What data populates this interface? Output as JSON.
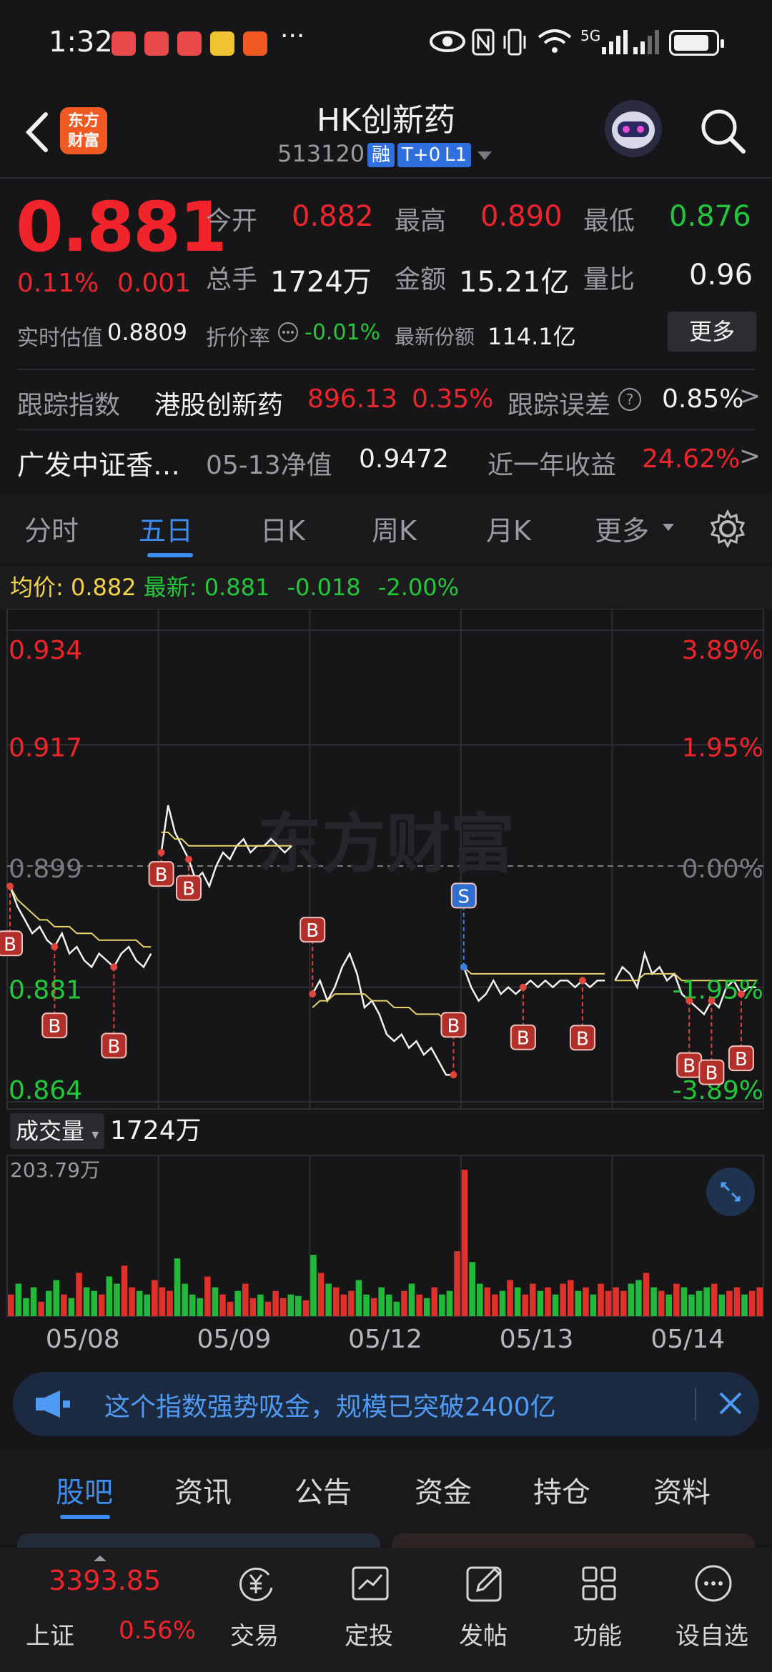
{
  "status_bar": {
    "time": "1:32",
    "more": "···",
    "network": "5G"
  },
  "header": {
    "logo_text_1": "东方",
    "logo_text_2": "财富",
    "title": "HK创新药",
    "code": "513120",
    "tags": [
      "融",
      "T+0",
      "L1"
    ]
  },
  "quote": {
    "price": "0.881",
    "change_pct": "0.11%",
    "change_amt": "0.001",
    "open_label": "今开",
    "open": "0.882",
    "high_label": "最高",
    "high": "0.890",
    "low_label": "最低",
    "low": "0.876",
    "volume_label": "总手",
    "volume": "1724万",
    "amount_label": "金额",
    "amount": "15.21亿",
    "ratio_label": "量比",
    "ratio": "0.96",
    "iopv_label": "实时估值",
    "iopv": "0.8809",
    "discount_label": "折价率",
    "discount": "-0.01%",
    "shares_label": "最新份额",
    "shares": "114.1亿",
    "more_btn": "更多"
  },
  "tracking": {
    "index_label": "跟踪指数",
    "index_name": "港股创新药",
    "index_value": "896.13",
    "index_pct": "0.35%",
    "error_label": "跟踪误差",
    "error_value": "0.85%",
    "fund_name": "广发中证香…",
    "nav_label": "05-13净值",
    "nav_value": "0.9472",
    "yield_label": "近一年收益",
    "yield_value": "24.62%",
    "chevron": ">"
  },
  "chart_tabs": [
    "分时",
    "五日",
    "日K",
    "周K",
    "月K",
    "更多"
  ],
  "chart_legend": {
    "avg_label": "均价:",
    "avg_value": "0.882",
    "latest_label": "最新:",
    "latest_value": "0.881",
    "chg": "-0.018",
    "chg_pct": "-2.00%"
  },
  "chart_data": {
    "type": "line",
    "x_labels": [
      "05/08",
      "05/09",
      "05/12",
      "05/13",
      "05/14"
    ],
    "y_left_ticks": [
      "0.934",
      "0.917",
      "0.899",
      "0.881",
      "0.864"
    ],
    "y_right_ticks": [
      "3.89%",
      "1.95%",
      "0.00%",
      "-1.95%",
      "-3.89%"
    ],
    "ylim": [
      0.864,
      0.934
    ],
    "prev_close": 0.899,
    "watermark": "东方财富",
    "series": [
      {
        "values": [
          0.896,
          0.893,
          0.891,
          0.889,
          0.89,
          0.888,
          0.887,
          0.889,
          0.886,
          0.887,
          0.885,
          0.884,
          0.886,
          0.885,
          0.884,
          0.886,
          0.887,
          0.885,
          0.884,
          0.886,
          0.901,
          0.908,
          0.904,
          0.902,
          0.9,
          0.897,
          0.898,
          0.896,
          0.899,
          0.901,
          0.9,
          0.902,
          0.903,
          0.901,
          0.902,
          0.902,
          0.903,
          0.902,
          0.901,
          0.902,
          0.88,
          0.882,
          0.879,
          0.881,
          0.884,
          0.886,
          0.883,
          0.878,
          0.879,
          0.877,
          0.874,
          0.873,
          0.874,
          0.872,
          0.873,
          0.871,
          0.872,
          0.87,
          0.868,
          0.868,
          0.884,
          0.881,
          0.879,
          0.88,
          0.882,
          0.88,
          0.881,
          0.88,
          0.881,
          0.882,
          0.881,
          0.882,
          0.881,
          0.882,
          0.882,
          0.881,
          0.882,
          0.881,
          0.882,
          0.882,
          0.882,
          0.884,
          0.883,
          0.881,
          0.886,
          0.883,
          0.884,
          0.882,
          0.883,
          0.88,
          0.879,
          0.878,
          0.877,
          0.879,
          0.878,
          0.881,
          0.882,
          0.88,
          0.881,
          0.881
        ]
      },
      {
        "values": [
          0.896,
          0.894,
          0.893,
          0.892,
          0.891,
          0.891,
          0.89,
          0.89,
          0.89,
          0.889,
          0.889,
          0.889,
          0.888,
          0.888,
          0.888,
          0.888,
          0.888,
          0.888,
          0.887,
          0.887,
          0.904,
          0.904,
          0.903,
          0.903,
          0.902,
          0.902,
          0.902,
          0.902,
          0.902,
          0.902,
          0.902,
          0.902,
          0.902,
          0.902,
          0.902,
          0.902,
          0.902,
          0.902,
          0.902,
          0.902,
          0.878,
          0.879,
          0.879,
          0.88,
          0.88,
          0.88,
          0.88,
          0.88,
          0.879,
          0.879,
          0.879,
          0.878,
          0.878,
          0.878,
          0.877,
          0.877,
          0.877,
          0.877,
          0.876,
          0.876,
          0.884,
          0.883,
          0.883,
          0.883,
          0.883,
          0.883,
          0.883,
          0.883,
          0.883,
          0.883,
          0.883,
          0.883,
          0.883,
          0.883,
          0.883,
          0.883,
          0.883,
          0.883,
          0.883,
          0.883,
          0.882,
          0.882,
          0.882,
          0.882,
          0.883,
          0.883,
          0.883,
          0.883,
          0.883,
          0.882,
          0.882,
          0.882,
          0.882,
          0.882,
          0.882,
          0.882,
          0.882,
          0.882,
          0.882,
          0.882
        ]
      }
    ],
    "buy_marker": "B",
    "sell_marker": "S",
    "volume": {
      "label": "成交量",
      "total": "1724万",
      "max_label": "203.79万",
      "values": [
        30,
        45,
        25,
        40,
        20,
        35,
        50,
        30,
        25,
        60,
        40,
        35,
        30,
        55,
        45,
        70,
        40,
        35,
        30,
        50,
        40,
        35,
        80,
        45,
        30,
        25,
        55,
        40,
        30,
        20,
        35,
        45,
        25,
        30,
        20,
        35,
        25,
        30,
        28,
        22,
        85,
        60,
        45,
        40,
        30,
        35,
        50,
        30,
        25,
        40,
        30,
        20,
        35,
        45,
        30,
        25,
        40,
        30,
        35,
        90,
        203,
        75,
        45,
        40,
        30,
        35,
        50,
        40,
        30,
        45,
        35,
        40,
        30,
        45,
        50,
        35,
        40,
        30,
        45,
        35,
        40,
        35,
        45,
        50,
        60,
        40,
        35,
        30,
        45,
        40,
        30,
        35,
        40,
        45,
        30,
        35,
        40,
        30,
        35,
        40
      ]
    }
  },
  "ad": {
    "text": "这个指数强势吸金，规模已突破2400亿"
  },
  "content_tabs": [
    "股吧",
    "资讯",
    "公告",
    "资金",
    "持仓",
    "资料"
  ],
  "footer": {
    "index_value": "3393.85",
    "index_name": "上证",
    "index_pct": "0.56%",
    "items": [
      "交易",
      "定投",
      "发帖",
      "功能",
      "设自选"
    ]
  },
  "colors": {
    "up": "#f0242a",
    "down": "#22c83a",
    "accent": "#3d8df0",
    "avg_line": "#e8d36a"
  }
}
